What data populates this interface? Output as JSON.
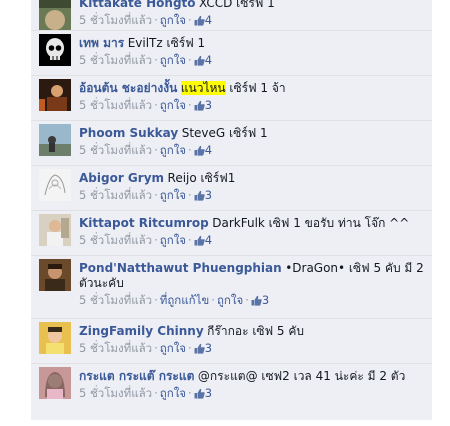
{
  "comments": [
    {
      "author": "Kittakate Hongto",
      "text": "XCCD เซิร์ฟ 1",
      "time": "5 ชั่วโมงที่แล้ว",
      "like": "ถูกใจ",
      "likes": "4"
    },
    {
      "author": "เทพ มาร",
      "text": "EvilTz เซิร์ฟ 1",
      "time": "5 ชั่วโมงที่แล้ว",
      "like": "ถูกใจ",
      "likes": "4"
    },
    {
      "author": "อ้อนต้น ชะอย่างงั้น",
      "highlight": "แนวไหน",
      "text": " เซิร์ฟ 1 จ้า",
      "time": "5 ชั่วโมงที่แล้ว",
      "like": "ถูกใจ",
      "likes": "3"
    },
    {
      "author": "Phoom Sukkay",
      "text": "SteveG เซิร์ฟ 1",
      "time": "5 ชั่วโมงที่แล้ว",
      "like": "ถูกใจ",
      "likes": "4"
    },
    {
      "author": "Abigor Grym",
      "text": "Reijo เซิร์ฟ1",
      "time": "5 ชั่วโมงที่แล้ว",
      "like": "ถูกใจ",
      "likes": "3"
    },
    {
      "author": "Kittapot Ritcumrop",
      "text": "DarkFulk เซิฟ 1 ขอรับ ท่าน โจ๊ก ^^",
      "time": "5 ชั่วโมงที่แล้ว",
      "like": "ถูกใจ",
      "likes": "4"
    },
    {
      "author": "Pond'Natthawut Phuengphian",
      "text": "•DraGon• เซิฟ 5 คับ มี 2 ตัวนะคับ",
      "time": "5 ชั่วโมงที่แล้ว",
      "edited": "ที่ถูกแก้ไข",
      "like": "ถูกใจ",
      "likes": "3"
    },
    {
      "author": "ZingFamily Chinny",
      "text": "กีร๊ากอะ เซิฟ 5 คับ",
      "time": "5 ชั่วโมงที่แล้ว",
      "like": "ถูกใจ",
      "likes": "3"
    },
    {
      "author": "กระแต กระแต๊ กระแต",
      "text": "@กระแต@ เซฟ2 เวล 41 น่ะค่ะ มี 2 ตัว",
      "time": "5 ชั่วโมงที่แล้ว",
      "like": "ถูกใจ",
      "likes": "3"
    }
  ],
  "colors": {
    "panel_bg": "#edeff4",
    "author": "#3b5998",
    "meta": "#9197a3",
    "highlight": "#ffff00"
  },
  "icons": {
    "like_count": "thumbs-up-icon"
  }
}
